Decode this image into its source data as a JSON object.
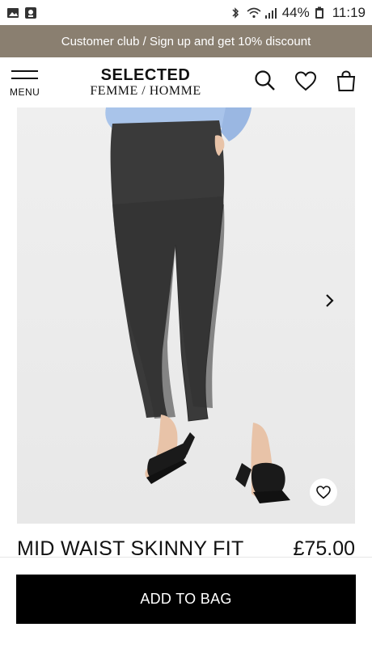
{
  "status_bar": {
    "battery": "44%",
    "time": "11:19",
    "icons": [
      "gallery-icon",
      "notification-icon",
      "bluetooth-icon",
      "wifi-icon",
      "signal-icon",
      "battery-icon"
    ]
  },
  "promo": {
    "text": "Customer club / Sign up and get 10% discount"
  },
  "header": {
    "menu_label": "MENU",
    "logo_line1": "SELECTED",
    "logo_line2": "FEMME / HOMME",
    "icons": [
      "search-icon",
      "heart-icon",
      "bag-icon"
    ]
  },
  "product": {
    "title": "MID WAIST SKINNY FIT",
    "price": "£75.00"
  },
  "actions": {
    "add_to_bag_label": "ADD TO BAG"
  }
}
